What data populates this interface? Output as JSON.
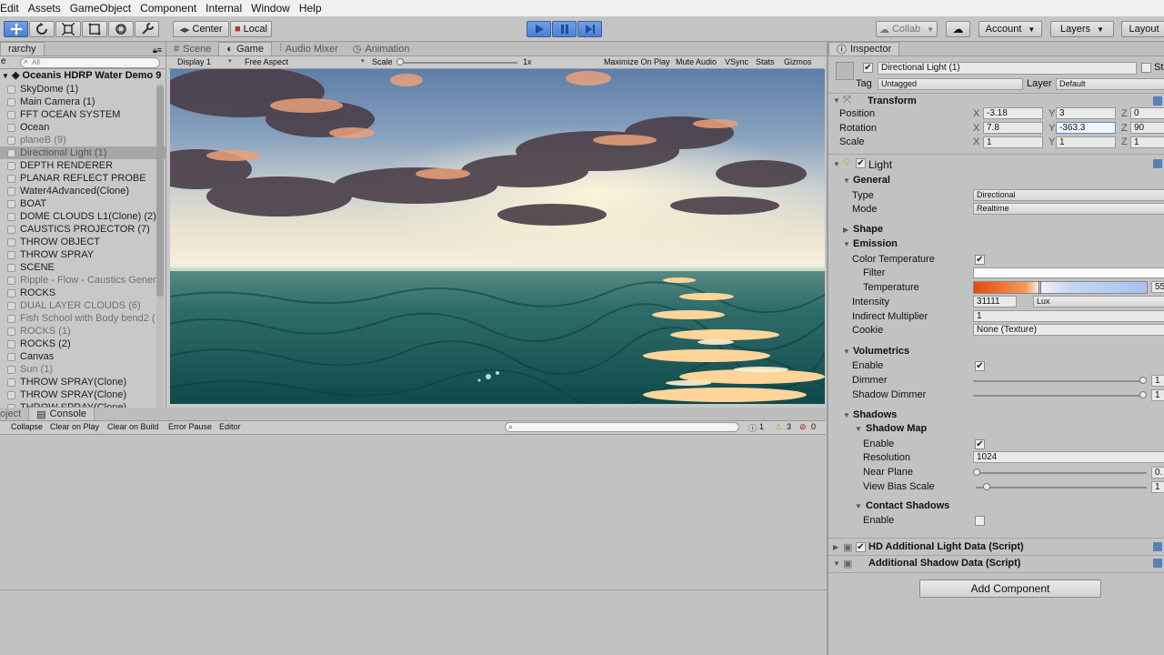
{
  "menu": [
    "Edit",
    "Assets",
    "GameObject",
    "Component",
    "Internal",
    "Window",
    "Help"
  ],
  "toolbar": {
    "pivot": "Center",
    "space": "Local",
    "collab": "Collab",
    "account": "Account",
    "layers": "Layers",
    "layout": "Layout"
  },
  "hierarchy": {
    "tab": "rarchy",
    "create": "e",
    "search_placeholder": "All",
    "scene": "Oceanis HDRP Water Demo 9",
    "items": [
      {
        "label": "SkyDome (1)",
        "state": "normal"
      },
      {
        "label": "Main Camera (1)",
        "state": "normal"
      },
      {
        "label": "FFT OCEAN SYSTEM",
        "state": "normal"
      },
      {
        "label": "Ocean",
        "state": "normal"
      },
      {
        "label": "planeB (9)",
        "state": "grey"
      },
      {
        "label": "Directional Light (1)",
        "state": "selected"
      },
      {
        "label": "DEPTH RENDERER",
        "state": "normal"
      },
      {
        "label": "PLANAR REFLECT PROBE",
        "state": "normal"
      },
      {
        "label": "Water4Advanced(Clone)",
        "state": "normal"
      },
      {
        "label": "BOAT",
        "state": "normal"
      },
      {
        "label": "DOME CLOUDS L1(Clone) (2)",
        "state": "normal"
      },
      {
        "label": "CAUSTICS PROJECTOR (7)",
        "state": "normal"
      },
      {
        "label": "THROW OBJECT",
        "state": "normal"
      },
      {
        "label": "THROW SPRAY",
        "state": "normal"
      },
      {
        "label": "SCENE",
        "state": "normal"
      },
      {
        "label": "Ripple - Flow - Caustics Gener",
        "state": "grey"
      },
      {
        "label": "ROCKS",
        "state": "normal"
      },
      {
        "label": "DUAL LAYER CLOUDS (6)",
        "state": "grey"
      },
      {
        "label": "Fish School with Body bend2 (",
        "state": "grey"
      },
      {
        "label": "ROCKS (1)",
        "state": "grey"
      },
      {
        "label": "ROCKS (2)",
        "state": "normal"
      },
      {
        "label": "Canvas",
        "state": "normal"
      },
      {
        "label": "Sun (1)",
        "state": "grey"
      },
      {
        "label": "THROW SPRAY(Clone)",
        "state": "normal"
      },
      {
        "label": "THROW SPRAY(Clone)",
        "state": "normal"
      },
      {
        "label": "THROW SPRAY(Clone)",
        "state": "normal"
      }
    ]
  },
  "view_tabs": {
    "scene": "Scene",
    "game": "Game",
    "audio": "Audio Mixer",
    "animation": "Animation"
  },
  "game": {
    "display": "Display 1",
    "aspect": "Free Aspect",
    "scale_label": "Scale",
    "scale_value": "1x",
    "maximize": "Maximize On Play",
    "mute": "Mute Audio",
    "vsync": "VSync",
    "stats": "Stats",
    "gizmos": "Gizmos"
  },
  "console": {
    "project_tab": "oject",
    "console_tab": "Console",
    "collapse": "Collapse",
    "clear_on_play": "Clear on Play",
    "clear_on_build": "Clear on Build",
    "error_pause": "Error Pause",
    "editor": "Editor",
    "info_count": "1",
    "warn_count": "3",
    "error_count": "0"
  },
  "inspector": {
    "tab": "Inspector",
    "object_name": "Directional Light (1)",
    "static": "Sta",
    "tag_label": "Tag",
    "tag": "Untagged",
    "layer_label": "Layer",
    "layer": "Default",
    "transform": {
      "title": "Transform",
      "position_label": "Position",
      "rotation_label": "Rotation",
      "scale_label": "Scale",
      "x": "X",
      "y": "Y",
      "z": "Z",
      "position": [
        "-3.18",
        "3",
        "0"
      ],
      "rotation": [
        "7.8",
        "-363.3",
        "90"
      ],
      "scale": [
        "1",
        "1",
        "1"
      ]
    },
    "light": {
      "title": "Light",
      "general": "General",
      "type_label": "Type",
      "type": "Directional",
      "mode_label": "Mode",
      "mode": "Realtime",
      "shape": "Shape",
      "emission": "Emission",
      "color_temp_label": "Color Temperature",
      "filter_label": "Filter",
      "temperature_label": "Temperature",
      "temperature_value": "55",
      "intensity_label": "Intensity",
      "intensity": "31111",
      "intensity_unit": "Lux",
      "indirect_label": "Indirect Multiplier",
      "indirect": "1",
      "cookie_label": "Cookie",
      "cookie": "None (Texture)",
      "volumetrics": "Volumetrics",
      "vol_enable_label": "Enable",
      "dimmer_label": "Dimmer",
      "dimmer": "1",
      "shadow_dimmer_label": "Shadow Dimmer",
      "shadow_dimmer": "1",
      "shadows": "Shadows",
      "shadow_map": "Shadow Map",
      "sm_enable_label": "Enable",
      "resolution_label": "Resolution",
      "resolution": "1024",
      "near_plane_label": "Near Plane",
      "near_plane": "0.",
      "view_bias_label": "View Bias Scale",
      "view_bias": "1",
      "contact_shadows": "Contact Shadows",
      "cs_enable_label": "Enable"
    },
    "hd_additional": "HD Additional Light Data (Script)",
    "additional_shadow": "Additional Shadow Data (Script)",
    "add_component": "Add Component"
  }
}
